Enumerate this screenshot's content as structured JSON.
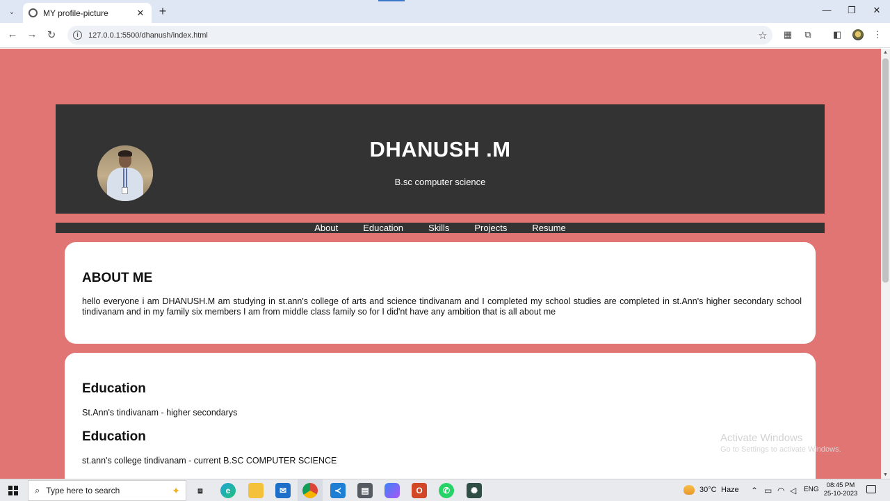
{
  "browser": {
    "tab_title": "MY profile-picture",
    "tab_close": "✕",
    "new_tab": "+",
    "url": "127.0.0.1:5500/dhanush/index.html",
    "window_controls": {
      "minimize": "—",
      "maximize": "❐",
      "close": "✕"
    }
  },
  "header": {
    "name": "DHANUSH .M",
    "subtitle": "B.sc computer science"
  },
  "nav": {
    "items": [
      "About",
      "Education",
      "Skills",
      "Projects",
      "Resume"
    ]
  },
  "about": {
    "heading": "ABOUT ME",
    "text": "hello everyone i am DHANUSH.M am studying in st.ann's college of arts and science tindivanam and I completed my school studies are completed in st.Ann's higher secondary school tindivanam and in my family six members I am from middle class family so for I did'nt have any ambition that is all about me"
  },
  "education": {
    "entries": [
      {
        "heading": "Education",
        "text": "St.Ann's tindivanam - higher secondarys"
      },
      {
        "heading": "Education",
        "text": "st.ann's college tindivanam - current B.SC COMPUTER SCIENCE"
      }
    ]
  },
  "watermark": {
    "line1": "Activate Windows",
    "line2": "Go to Settings to activate Windows."
  },
  "taskbar": {
    "search_placeholder": "Type here to search",
    "weather_temp": "30°C",
    "weather_desc": "Haze",
    "language": "ENG",
    "time": "08:45 PM",
    "date": "25-10-2023",
    "apps": [
      "task-view",
      "edge",
      "file-explorer",
      "mail",
      "chrome",
      "vscode",
      "calculator",
      "copilot",
      "office",
      "whatsapp",
      "chatgpt"
    ]
  },
  "colors": {
    "page_bg": "#e07573",
    "header_bg": "#333333",
    "card_bg": "#ffffff"
  }
}
